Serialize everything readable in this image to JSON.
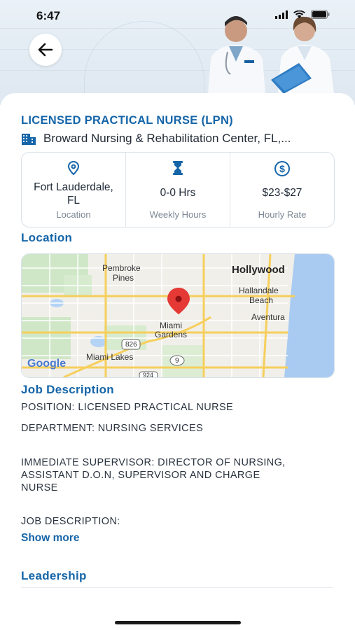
{
  "status_bar": {
    "time": "6:47"
  },
  "job": {
    "title": "LICENSED PRACTICAL NURSE (LPN)",
    "facility": "Broward Nursing & Rehabilitation Center, FL,..."
  },
  "info": [
    {
      "icon": "location-pin-icon",
      "value_line1": "Fort Lauderdale,",
      "value_line2": "FL",
      "label": "Location"
    },
    {
      "icon": "hourglass-icon",
      "value_line1": "0-0 Hrs",
      "label": "Weekly Hours"
    },
    {
      "icon": "dollar-circle-icon",
      "value_line1": "$23-$27",
      "label": "Hourly Rate"
    }
  ],
  "sections": {
    "location": "Location",
    "job_description": "Job Description",
    "leadership": "Leadership"
  },
  "map": {
    "labels": {
      "pembroke": "Pembroke",
      "pines": "Pines",
      "hollywood": "Hollywood",
      "hallandale": "Hallandale",
      "beach": "Beach",
      "aventura": "Aventura",
      "miami": "Miami",
      "gardens": "Gardens",
      "miami_lakes": "Miami Lakes",
      "route_826": "826",
      "route_9": "9",
      "route_924": "924",
      "google": "Google"
    }
  },
  "description": {
    "position": "POSITION: LICENSED PRACTICAL NURSE",
    "department": "DEPARTMENT: NURSING SERVICES",
    "supervisor_line1": "IMMEDIATE SUPERVISOR: DIRECTOR OF NURSING,",
    "supervisor_line2": "ASSISTANT D.O.N, SUPERVISOR AND CHARGE",
    "supervisor_line3": "NURSE",
    "job_description_label": "JOB DESCRIPTION:",
    "show_more": "Show more"
  },
  "colors": {
    "accent": "#1565a8",
    "pin": "#e53935"
  }
}
